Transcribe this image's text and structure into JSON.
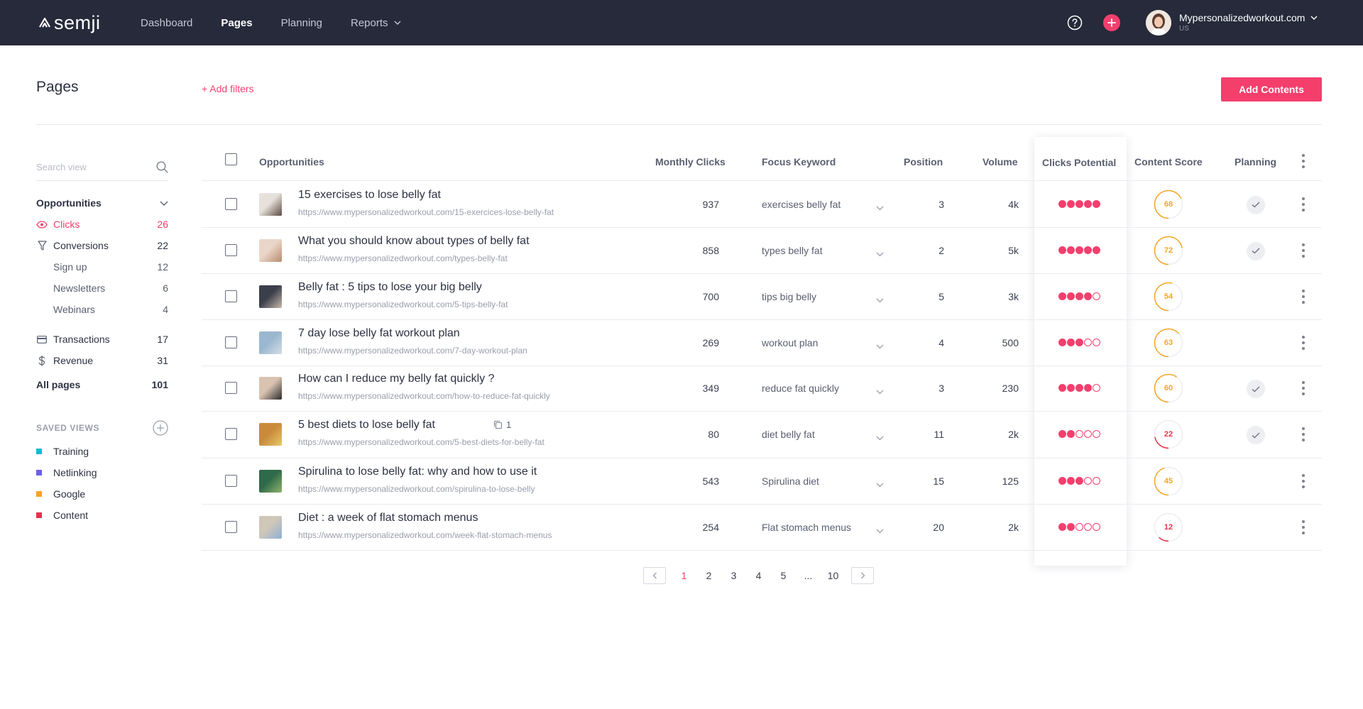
{
  "app": {
    "logo_text": "semji"
  },
  "nav": {
    "items": [
      {
        "label": "Dashboard",
        "active": false
      },
      {
        "label": "Pages",
        "active": true
      },
      {
        "label": "Planning",
        "active": false
      },
      {
        "label": "Reports",
        "active": false,
        "has_dropdown": true
      }
    ]
  },
  "account": {
    "name": "Mypersonalizedworkout.com",
    "country": "US"
  },
  "header": {
    "title": "Pages",
    "add_filters": "+ Add filters",
    "add_contents": "Add Contents"
  },
  "sidebar": {
    "search_placeholder": "Search view",
    "opportunities_label": "Opportunities",
    "clicks": {
      "label": "Clicks",
      "count": "26"
    },
    "conversions": {
      "label": "Conversions",
      "count": "22"
    },
    "sub_items": [
      {
        "label": "Sign up",
        "count": "12"
      },
      {
        "label": "Newsletters",
        "count": "6"
      },
      {
        "label": "Webinars",
        "count": "4"
      }
    ],
    "transactions": {
      "label": "Transactions",
      "count": "17"
    },
    "revenue": {
      "label": "Revenue",
      "count": "31"
    },
    "all_pages": {
      "label": "All pages",
      "count": "101"
    },
    "saved_views_title": "SAVED VIEWS",
    "saved_views": [
      {
        "label": "Training",
        "color": "#17b9d6"
      },
      {
        "label": "Netlinking",
        "color": "#6b5ee8"
      },
      {
        "label": "Google",
        "color": "#f7a41d"
      },
      {
        "label": "Content",
        "color": "#e0334f"
      }
    ]
  },
  "table": {
    "headers": {
      "opportunities": "Opportunities",
      "monthly_clicks": "Monthly Clicks",
      "focus_keyword": "Focus Keyword",
      "position": "Position",
      "volume": "Volume",
      "clicks_potential": "Clicks Potential",
      "content_score": "Content Score",
      "planning": "Planning"
    },
    "rows": [
      {
        "title": "15 exercises to lose belly fat",
        "url": "https://www.mypersonalizedworkout.com/15-exercices-lose-belly-fat",
        "clicks": "937",
        "keyword": "exercises belly fat",
        "position": "3",
        "volume": "4k",
        "potential": 5,
        "score": "68",
        "score_fraction": 0.68,
        "planned": true
      },
      {
        "title": "What you should know about types of belly fat",
        "url": "https://www.mypersonalizedworkout.com/types-belly-fat",
        "clicks": "858",
        "keyword": "types belly fat",
        "position": "2",
        "volume": "5k",
        "potential": 5,
        "score": "72",
        "score_fraction": 0.72,
        "planned": true
      },
      {
        "title": "Belly fat : 5 tips to lose your big belly",
        "url": "https://www.mypersonalizedworkout.com/5-tips-belly-fat",
        "clicks": "700",
        "keyword": "tips big belly",
        "position": "5",
        "volume": "3k",
        "potential": 4,
        "score": "54",
        "score_fraction": 0.54,
        "planned": false
      },
      {
        "title": "7 day lose belly fat workout plan",
        "url": "https://www.mypersonalizedworkout.com/7-day-workout-plan",
        "clicks": "269",
        "keyword": "workout plan",
        "position": "4",
        "volume": "500",
        "potential": 3,
        "score": "63",
        "score_fraction": 0.63,
        "planned": false
      },
      {
        "title": "How can I reduce my belly fat quickly ?",
        "url": "https://www.mypersonalizedworkout.com/how-to-reduce-fat-quickly",
        "clicks": "349",
        "keyword": "reduce fat quickly",
        "position": "3",
        "volume": "230",
        "potential": 4,
        "score": "60",
        "score_fraction": 0.6,
        "planned": true
      },
      {
        "title": "5 best diets to lose belly fat",
        "url": "https://www.mypersonalizedworkout.com/5-best-diets-for-belly-fat",
        "clicks": "80",
        "keyword": "diet belly fat",
        "position": "11",
        "volume": "2k",
        "potential": 2,
        "score": "22",
        "score_fraction": 0.22,
        "planned": true,
        "copies": "1"
      },
      {
        "title": "Spirulina to lose belly fat: why and how to use it",
        "url": "https://www.mypersonalizedworkout.com/spirulina-to-lose-belly",
        "clicks": "543",
        "keyword": "Spirulina diet",
        "position": "15",
        "volume": "125",
        "potential": 3,
        "score": "45",
        "score_fraction": 0.45,
        "planned": false
      },
      {
        "title": "Diet : a week of flat stomach menus",
        "url": "https://www.mypersonalizedworkout.com/week-flat-stomach-menus",
        "clicks": "254",
        "keyword": "Flat stomach menus",
        "position": "20",
        "volume": "2k",
        "potential": 2,
        "score": "12",
        "score_fraction": 0.12,
        "planned": false
      }
    ]
  },
  "pagination": {
    "pages": [
      "1",
      "2",
      "3",
      "4",
      "5",
      "...",
      "10"
    ],
    "current": "1"
  },
  "colors": {
    "accent": "#f43f6d",
    "nav_bg": "#262a3a",
    "score_orange": "#f5a623",
    "score_red": "#e8334a"
  }
}
